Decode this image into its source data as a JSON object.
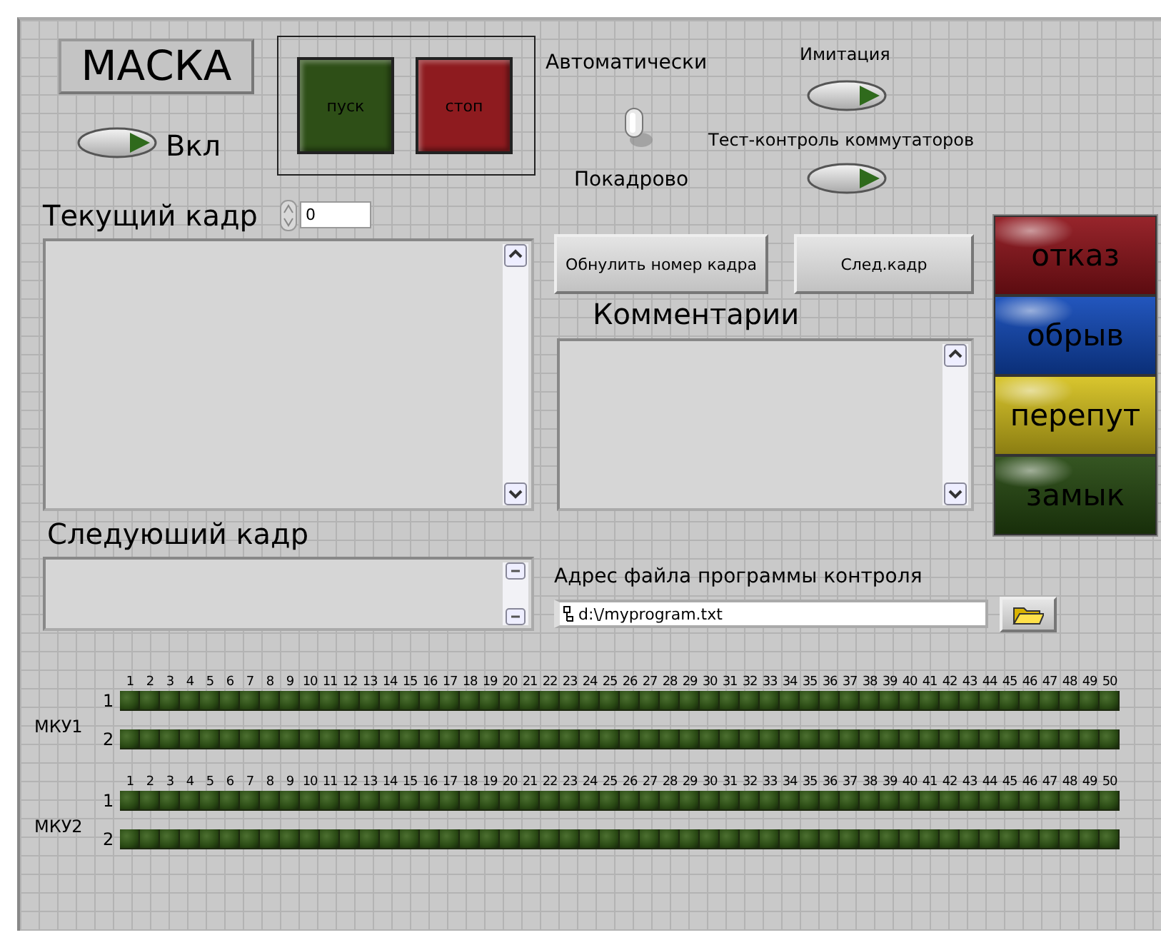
{
  "mask_title": "МАСКА",
  "power": {
    "label": "Вкл",
    "on": false
  },
  "run_buttons": [
    {
      "label": "пуск",
      "color": "#2e4f17"
    },
    {
      "label": "стоп",
      "color": "#8e1b1f"
    }
  ],
  "mode_switch": {
    "top_label": "Автоматически",
    "bottom_label": "Покадрово",
    "up": true
  },
  "toggles": [
    {
      "label": "Имитация",
      "on": false
    },
    {
      "label": "Тест-контроль коммутаторов",
      "on": false
    }
  ],
  "current_frame": {
    "label": "Текущий кадр",
    "number": "0"
  },
  "frame_buttons": [
    "Обнулить номер кадра",
    "След.кадр"
  ],
  "comments": {
    "label": "Комментарии"
  },
  "status_buttons": [
    {
      "label": "отказ",
      "color": "#8e1219"
    },
    {
      "label": "обрыв",
      "color": "#1048b8"
    },
    {
      "label": "перепут",
      "color": "#d6c11c"
    },
    {
      "label": "замык",
      "color": "#24470f"
    }
  ],
  "next_frame": {
    "label": "Следуюший кадр"
  },
  "program_file": {
    "label": "Адрес файла программы контроля",
    "path": "d:\\/myprogram.txt"
  },
  "led_groups": [
    {
      "label": "МКУ1",
      "columns": [
        "1",
        "2",
        "3",
        "4",
        "5",
        "6",
        "7",
        "8",
        "9",
        "10",
        "11",
        "12",
        "13",
        "14",
        "15",
        "16",
        "17",
        "18",
        "19",
        "20",
        "21",
        "22",
        "23",
        "24",
        "25",
        "26",
        "27",
        "28",
        "29",
        "30",
        "31",
        "32",
        "33",
        "34",
        "35",
        "36",
        "37",
        "38",
        "39",
        "40",
        "41",
        "42",
        "43",
        "44",
        "45",
        "46",
        "47",
        "48",
        "49",
        "50"
      ],
      "rows": [
        {
          "label": "1",
          "leds": [
            false,
            false,
            false,
            false,
            false,
            false,
            false,
            false,
            false,
            false,
            false,
            false,
            false,
            false,
            false,
            false,
            false,
            false,
            false,
            false,
            false,
            false,
            false,
            false,
            false,
            false,
            false,
            false,
            false,
            false,
            false,
            false,
            false,
            false,
            false,
            false,
            false,
            false,
            false,
            false,
            false,
            false,
            false,
            false,
            false,
            false,
            false,
            false,
            false,
            false
          ]
        },
        {
          "label": "2",
          "leds": [
            false,
            false,
            false,
            false,
            false,
            false,
            false,
            false,
            false,
            false,
            false,
            false,
            false,
            false,
            false,
            false,
            false,
            false,
            false,
            false,
            false,
            false,
            false,
            false,
            false,
            false,
            false,
            false,
            false,
            false,
            false,
            false,
            false,
            false,
            false,
            false,
            false,
            false,
            false,
            false,
            false,
            false,
            false,
            false,
            false,
            false,
            false,
            false,
            false,
            false
          ]
        }
      ]
    },
    {
      "label": "МКУ2",
      "columns": [
        "1",
        "2",
        "3",
        "4",
        "5",
        "6",
        "7",
        "8",
        "9",
        "10",
        "11",
        "12",
        "13",
        "14",
        "15",
        "16",
        "17",
        "18",
        "19",
        "20",
        "21",
        "22",
        "23",
        "24",
        "25",
        "26",
        "27",
        "28",
        "29",
        "30",
        "31",
        "32",
        "33",
        "34",
        "35",
        "36",
        "37",
        "38",
        "39",
        "40",
        "41",
        "42",
        "43",
        "44",
        "45",
        "46",
        "47",
        "48",
        "49",
        "50"
      ],
      "rows": [
        {
          "label": "1",
          "leds": [
            false,
            false,
            false,
            false,
            false,
            false,
            false,
            false,
            false,
            false,
            false,
            false,
            false,
            false,
            false,
            false,
            false,
            false,
            false,
            false,
            false,
            false,
            false,
            false,
            false,
            false,
            false,
            false,
            false,
            false,
            false,
            false,
            false,
            false,
            false,
            false,
            false,
            false,
            false,
            false,
            false,
            false,
            false,
            false,
            false,
            false,
            false,
            false,
            false,
            false
          ]
        },
        {
          "label": "2",
          "leds": [
            false,
            false,
            false,
            false,
            false,
            false,
            false,
            false,
            false,
            false,
            false,
            false,
            false,
            false,
            false,
            false,
            false,
            false,
            false,
            false,
            false,
            false,
            false,
            false,
            false,
            false,
            false,
            false,
            false,
            false,
            false,
            false,
            false,
            false,
            false,
            false,
            false,
            false,
            false,
            false,
            false,
            false,
            false,
            false,
            false,
            false,
            false,
            false,
            false,
            false
          ]
        }
      ]
    }
  ]
}
